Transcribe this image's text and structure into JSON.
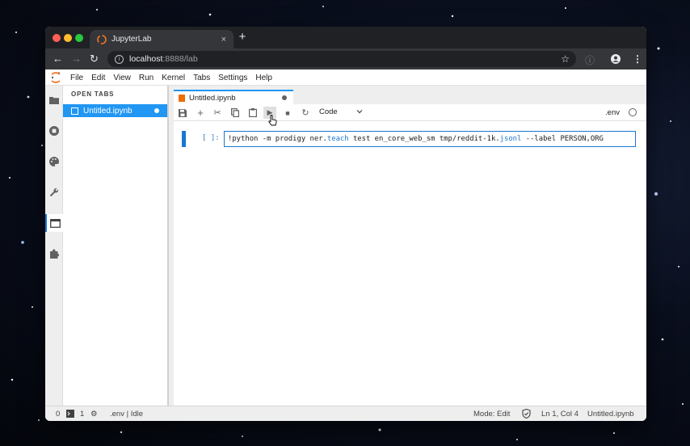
{
  "browser": {
    "tab_title": "JupyterLab",
    "tab_close": "×",
    "new_tab": "+",
    "address_host": "localhost",
    "address_path": ":8888/lab",
    "traffic_colors": [
      "#ff5f57",
      "#febc2e",
      "#28c840"
    ]
  },
  "menu": [
    "File",
    "Edit",
    "View",
    "Run",
    "Kernel",
    "Tabs",
    "Settings",
    "Help"
  ],
  "left_icons": [
    "folder-icon",
    "running-icon",
    "palette-icon",
    "wrench-icon",
    "tabs-icon",
    "extension-icon"
  ],
  "file_panel": {
    "heading": "OPEN TABS",
    "items": [
      {
        "label": "Untitled.ipynb",
        "dirty": true
      }
    ]
  },
  "notebook": {
    "tab_label": "Untitled.ipynb",
    "toolbar": {
      "tools": [
        "save-icon",
        "add-cell-icon",
        "cut-icon",
        "copy-icon",
        "paste-icon",
        "run-icon",
        "stop-icon",
        "restart-icon"
      ],
      "cell_type": "Code",
      "kernel_name": ".env"
    },
    "cell": {
      "prompt": "[ ]:",
      "code": {
        "part1": "!python -m prodigy ner.",
        "part2": "teach",
        "part3": " test en_core_web_sm tmp/reddit-1k.",
        "part4": "jsonl",
        "part5": " --label PERSON,ORG"
      }
    }
  },
  "statusbar": {
    "count0": "0",
    "terminal_count": "1",
    "kernel_info": ".env | Idle",
    "mode": "Mode: Edit",
    "position": "Ln 1, Col 4",
    "file": "Untitled.ipynb"
  },
  "colors": {
    "accent": "#2196f3",
    "brand": "#f37726",
    "chrome_dark": "#202124"
  }
}
